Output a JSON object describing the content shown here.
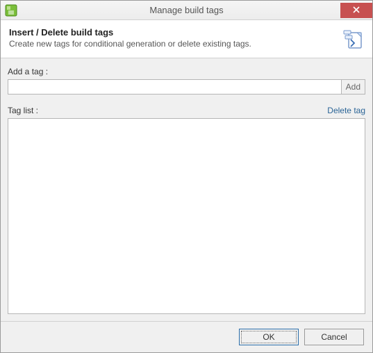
{
  "window": {
    "title": "Manage build tags"
  },
  "header": {
    "heading": "Insert / Delete build tags",
    "subheading": "Create new tags for conditional generation or delete existing tags."
  },
  "body": {
    "add_label": "Add a tag :",
    "add_input_value": "",
    "add_button_label": "Add",
    "taglist_label": "Tag list :",
    "delete_tag_label": "Delete tag",
    "tag_items": []
  },
  "footer": {
    "ok_label": "OK",
    "cancel_label": "Cancel"
  }
}
